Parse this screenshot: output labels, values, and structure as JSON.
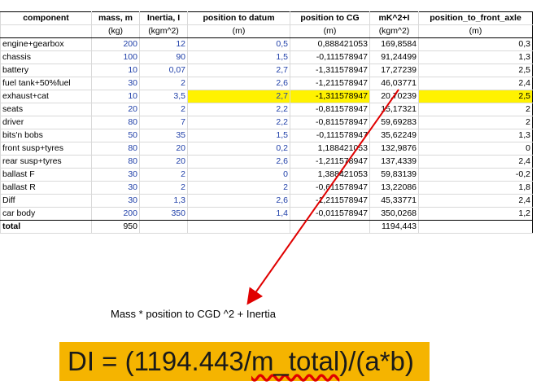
{
  "headers": [
    "component",
    "mass, m",
    "Inertia, I",
    "position to datum",
    "position to CG",
    "mK^2+I",
    "position_to_front_axle"
  ],
  "units": [
    "",
    "(kg)",
    "(kgm^2)",
    "(m)",
    "(m)",
    "(kgm^2)",
    "(m)"
  ],
  "rows": [
    {
      "component": "engine+gearbox",
      "mass": "200",
      "inertia": "12",
      "datum": "0,5",
      "cg": "0,888421053",
      "mk2i": "169,8584",
      "axle": "0,3"
    },
    {
      "component": "chassis",
      "mass": "100",
      "inertia": "90",
      "datum": "1,5",
      "cg": "-0,111578947",
      "mk2i": "91,24499",
      "axle": "1,3"
    },
    {
      "component": "battery",
      "mass": "10",
      "inertia": "0,07",
      "datum": "2,7",
      "cg": "-1,311578947",
      "mk2i": "17,27239",
      "axle": "2,5"
    },
    {
      "component": "fuel tank+50%fuel",
      "mass": "30",
      "inertia": "2",
      "datum": "2,6",
      "cg": "-1,211578947",
      "mk2i": "46,03771",
      "axle": "2,4"
    },
    {
      "component": "exhaust+cat",
      "mass": "10",
      "inertia": "3,5",
      "datum": "2,7",
      "cg": "-1,311578947",
      "mk2i": "20,70239",
      "axle": "2,5"
    },
    {
      "component": "seats",
      "mass": "20",
      "inertia": "2",
      "datum": "2,2",
      "cg": "-0,811578947",
      "mk2i": "15,17321",
      "axle": "2"
    },
    {
      "component": "driver",
      "mass": "80",
      "inertia": "7",
      "datum": "2,2",
      "cg": "-0,811578947",
      "mk2i": "59,69283",
      "axle": "2"
    },
    {
      "component": "bits'n bobs",
      "mass": "50",
      "inertia": "35",
      "datum": "1,5",
      "cg": "-0,111578947",
      "mk2i": "35,62249",
      "axle": "1,3"
    },
    {
      "component": "front susp+tyres",
      "mass": "80",
      "inertia": "20",
      "datum": "0,2",
      "cg": "1,188421053",
      "mk2i": "132,9876",
      "axle": "0"
    },
    {
      "component": "rear susp+tyres",
      "mass": "80",
      "inertia": "20",
      "datum": "2,6",
      "cg": "-1,211578947",
      "mk2i": "137,4339",
      "axle": "2,4"
    },
    {
      "component": "ballast F",
      "mass": "30",
      "inertia": "2",
      "datum": "0",
      "cg": "1,388421053",
      "mk2i": "59,83139",
      "axle": "-0,2"
    },
    {
      "component": "ballast R",
      "mass": "30",
      "inertia": "2",
      "datum": "2",
      "cg": "-0,611578947",
      "mk2i": "13,22086",
      "axle": "1,8"
    },
    {
      "component": "Diff",
      "mass": "30",
      "inertia": "1,3",
      "datum": "2,6",
      "cg": "-1,211578947",
      "mk2i": "45,33771",
      "axle": "2,4"
    },
    {
      "component": "car body",
      "mass": "200",
      "inertia": "350",
      "datum": "1,4",
      "cg": "-0,011578947",
      "mk2i": "350,0268",
      "axle": "1,2"
    }
  ],
  "total": {
    "label": "total",
    "mass": "950",
    "mk2i": "1194,443"
  },
  "annotation": "Mass * position to CGD ^2 + Inertia",
  "formula": {
    "prefix": "DI = (1194.443/",
    "squiggle": "m_total",
    "suffix": ")/(a*b)"
  },
  "colors": {
    "highlight": "#fff200",
    "formula_bg": "#f5b400",
    "arrow": "#e00000",
    "input_text": "#1f3fa8"
  }
}
